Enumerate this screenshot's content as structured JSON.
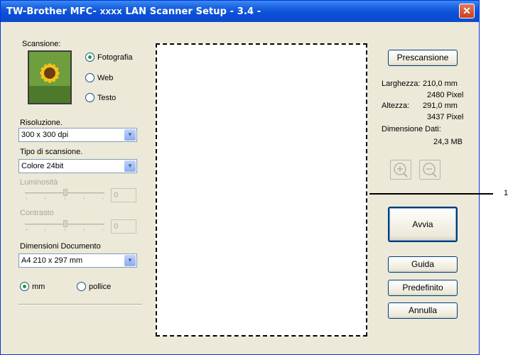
{
  "window": {
    "title_prefix": "TW-Brother MFC- ",
    "title_model": "XXXX",
    "title_suffix": "  LAN Scanner Setup - 3.4 -",
    "close_glyph": "✕"
  },
  "left": {
    "scan_label": "Scansione:",
    "scan_options": [
      {
        "label": "Fotografia",
        "selected": true
      },
      {
        "label": "Web",
        "selected": false
      },
      {
        "label": "Testo",
        "selected": false
      }
    ],
    "resolution_label": "Risoluzione.",
    "resolution_value": "300 x 300 dpi",
    "scan_type_label": "Tipo di scansione.",
    "scan_type_value": "Colore 24bit",
    "brightness_label": "Luminosità",
    "brightness_value": "0",
    "contrast_label": "Contrasto",
    "contrast_value": "0",
    "doc_size_label": "Dimensioni Documento",
    "doc_size_value": "A4 210 x 297 mm",
    "units": [
      {
        "label": "mm",
        "selected": true
      },
      {
        "label": "pollice",
        "selected": false
      }
    ]
  },
  "right": {
    "prescan_label": "Prescansione",
    "width_label": "Larghezza:",
    "width_mm": "210,0 mm",
    "width_px": "2480 Pixel",
    "height_label": "Altezza:",
    "height_mm": "291,0 mm",
    "height_px": "3437 Pixel",
    "data_size_label": "Dimensione Dati:",
    "data_size_value": "24,3 MB",
    "start_label": "Avvia",
    "help_label": "Guida",
    "default_label": "Predefinito",
    "cancel_label": "Annulla"
  },
  "callout_mark": "1"
}
